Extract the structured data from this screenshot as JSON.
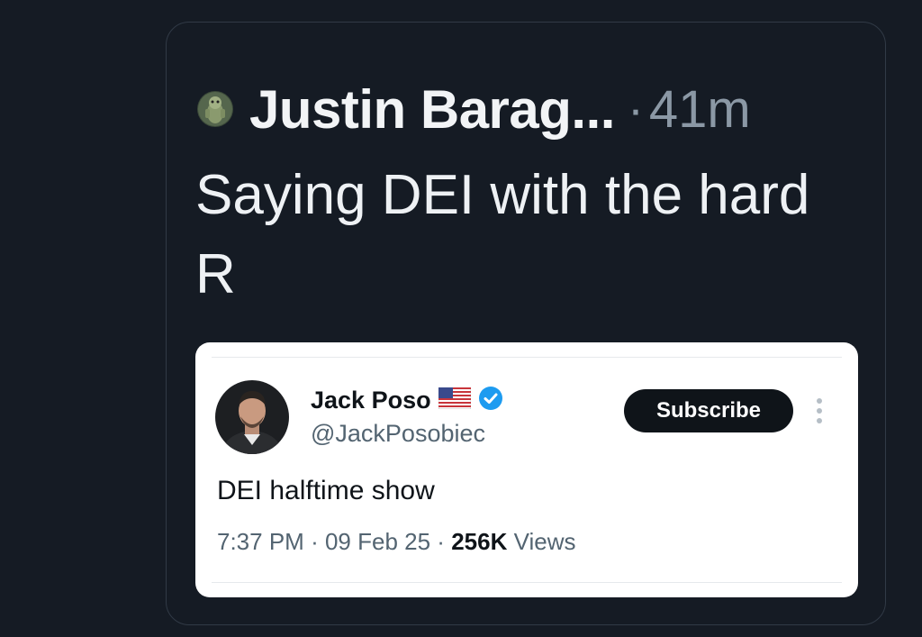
{
  "post": {
    "author_display": "Justin Barag...",
    "separator": "·",
    "time": "41m",
    "text": "Saying DEI with the hard R",
    "avatar_icon": "cartoon-avatar-icon"
  },
  "quoted_post": {
    "name": "Jack Poso",
    "flag_icon": "us-flag-icon",
    "verified_icon": "verified-badge-icon",
    "handle": "@JackPosobiec",
    "subscribe_label": "Subscribe",
    "more_icon": "more-options-icon",
    "text": "DEI halftime show",
    "time": "7:37 PM",
    "sep1": "·",
    "date": "09 Feb 25",
    "sep2": "·",
    "views_count": "256K",
    "views_label": "Views"
  },
  "colors": {
    "background": "#151b24",
    "card_border": "#313a46",
    "primary_text": "#f2f4f6",
    "secondary_text": "#8b98a5",
    "quote_bg": "#ffffff",
    "verified_blue": "#1d9bf0",
    "button_bg": "#0f1419"
  }
}
